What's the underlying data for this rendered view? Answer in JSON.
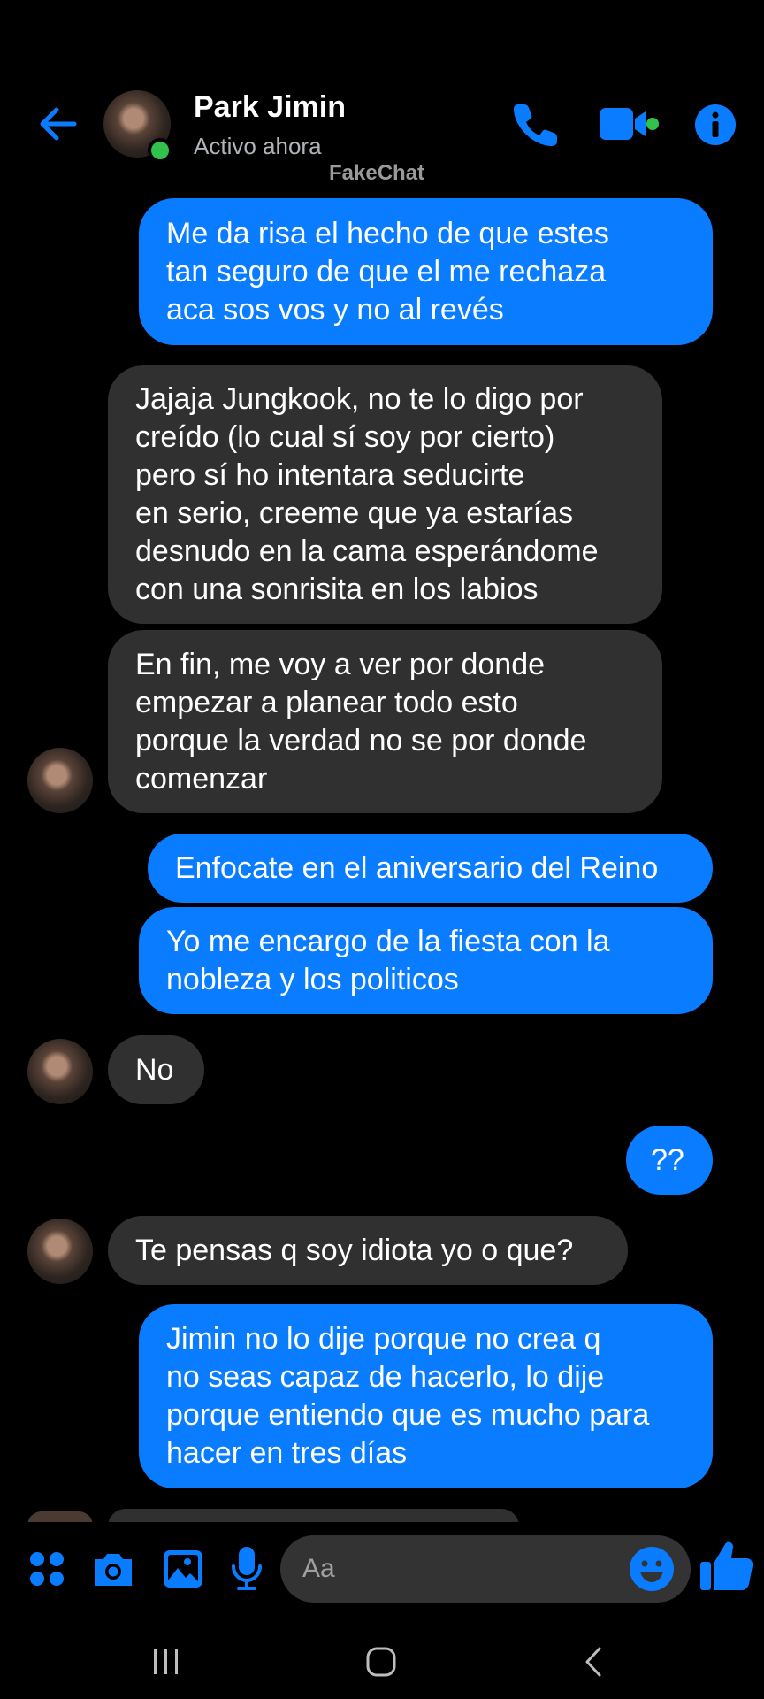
{
  "header": {
    "contact_name": "Park Jimin",
    "status": "Activo ahora",
    "watermark": "FakeChat"
  },
  "messages": [
    {
      "side": "out",
      "lines": [
        "Me da risa el hecho de que estes",
        "tan seguro de que el me rechaza",
        "aca sos vos y no al revés"
      ]
    },
    {
      "side": "in",
      "lines": [
        "Jajaja Jungkook, no te lo digo por",
        "creído (lo cual sí soy por cierto)",
        "pero sí ho intentara seducirte",
        "en serio, creeme que ya estarías",
        "desnudo en la cama esperándome",
        "con una sonrisita en los labios"
      ]
    },
    {
      "side": "in",
      "lines": [
        "En fin, me voy a ver por donde",
        "empezar a planear todo esto",
        "porque la verdad no se por donde",
        "comenzar"
      ]
    },
    {
      "side": "out",
      "lines": [
        "Enfocate en el aniversario del Reino"
      ]
    },
    {
      "side": "out",
      "lines": [
        "Yo me encargo de la fiesta con la",
        "nobleza y los politicos"
      ]
    },
    {
      "side": "in",
      "lines": [
        "No"
      ]
    },
    {
      "side": "out",
      "lines": [
        "??"
      ]
    },
    {
      "side": "in",
      "lines": [
        "Te pensas q soy idiota yo o que?"
      ]
    },
    {
      "side": "out",
      "lines": [
        "Jimin no lo dije porque no crea q",
        "no seas capaz de hacerlo, lo dije",
        "porque entiendo que es mucho para",
        "hacer en tres días"
      ]
    }
  ],
  "composer": {
    "placeholder": "Aa"
  },
  "icons": {
    "back": "arrow-left-icon",
    "call": "phone-icon",
    "video": "video-camera-icon",
    "info": "info-icon",
    "apps": "apps-grid-icon",
    "camera": "camera-icon",
    "gallery": "image-icon",
    "mic": "microphone-icon",
    "emoji": "emoji-icon",
    "like": "thumbs-up-icon"
  },
  "colors": {
    "accent": "#0a7cff",
    "background": "#000000",
    "incoming_bubble": "#303030",
    "online": "#31c24d"
  }
}
